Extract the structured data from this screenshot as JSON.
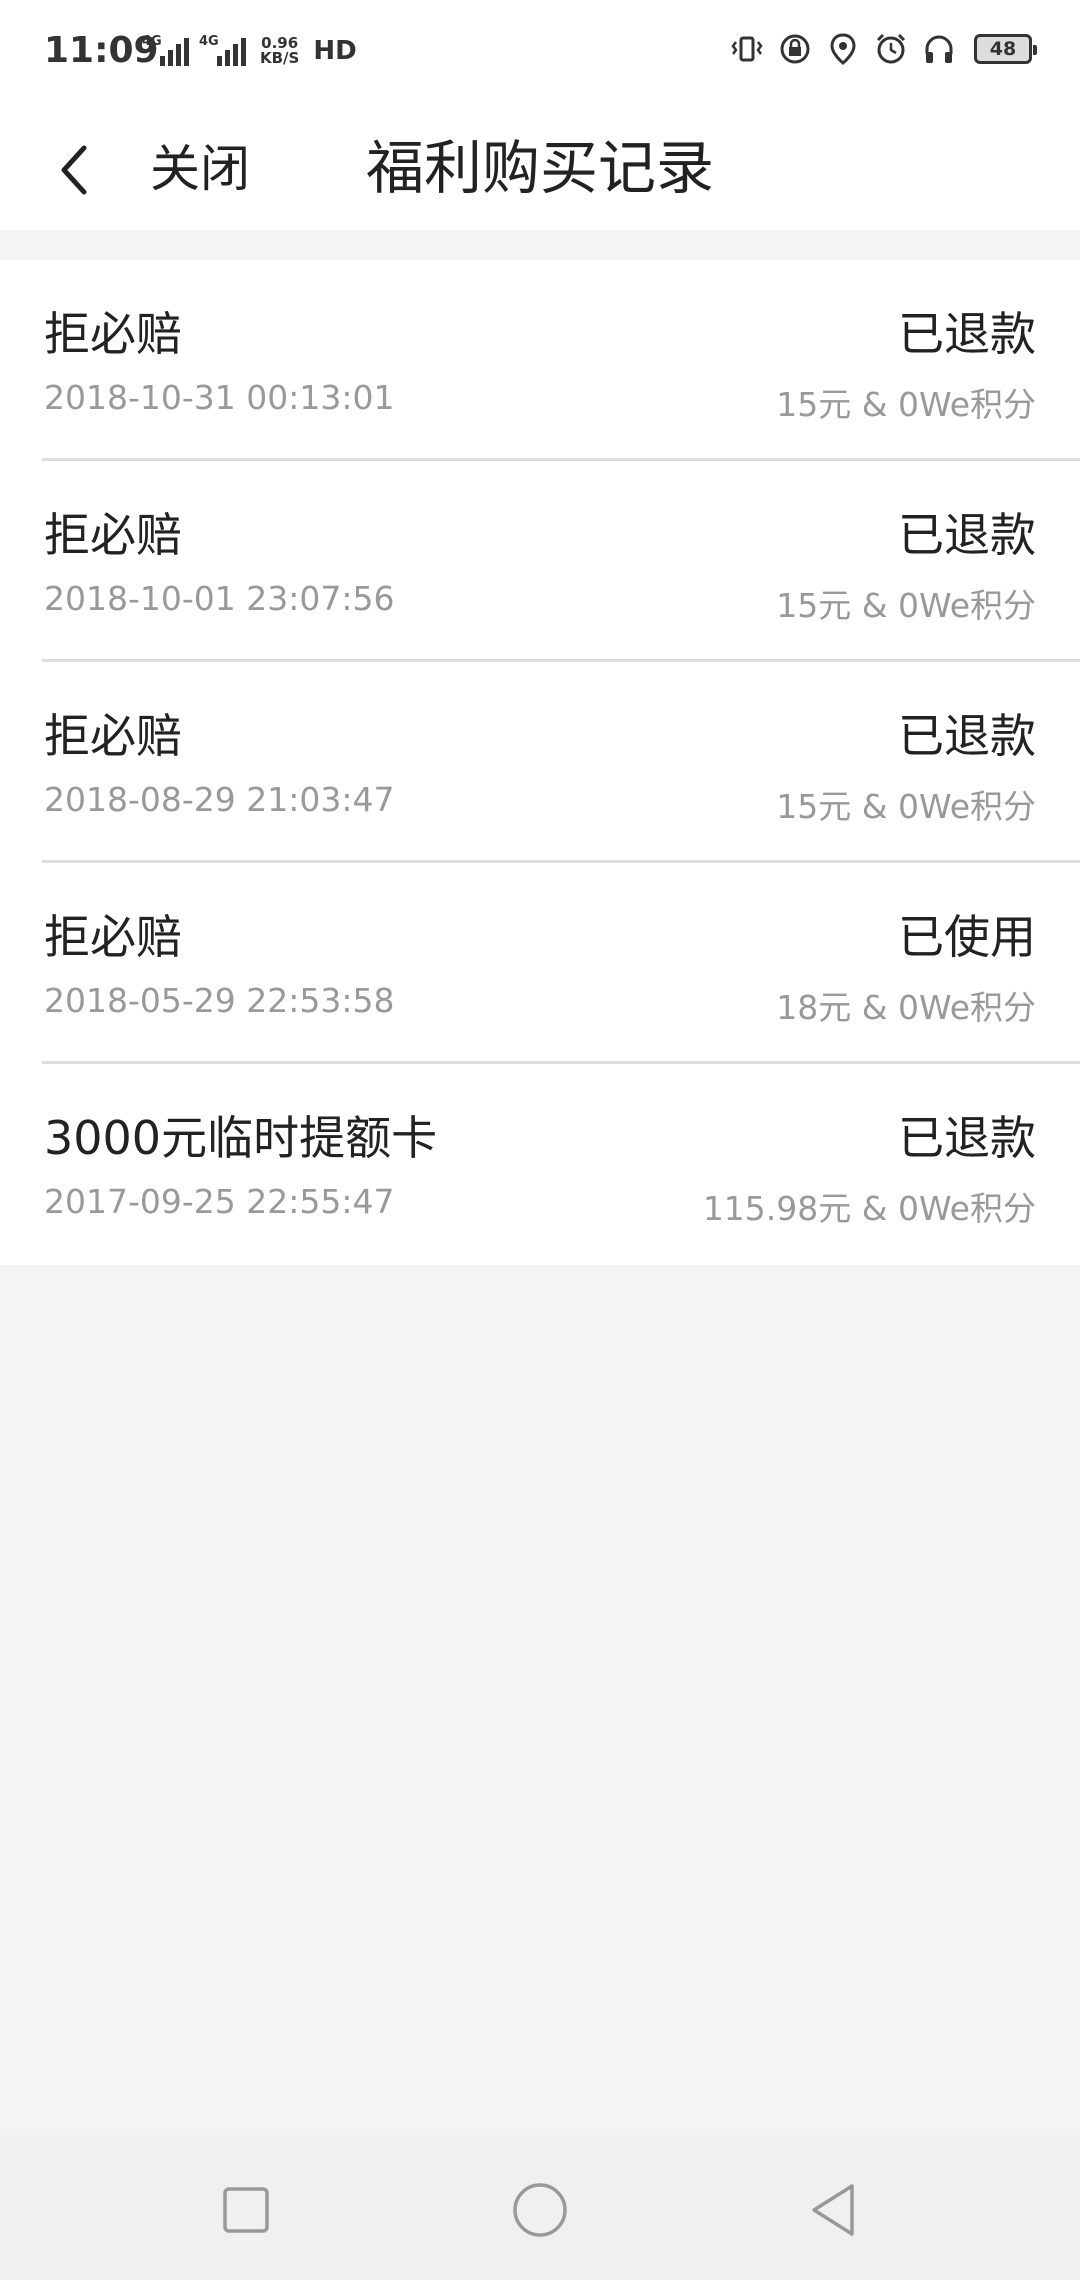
{
  "status_bar": {
    "time": "11:09",
    "net1": "4G",
    "net2": "4G",
    "speed_value": "0.96",
    "speed_unit": "KB/S",
    "hd": "HD",
    "battery": "48"
  },
  "header": {
    "close_label": "关闭",
    "title": "福利购买记录"
  },
  "records": [
    {
      "name": "拒必赔",
      "status": "已退款",
      "time": "2018-10-31 00:13:01",
      "price": "15元 & 0We积分"
    },
    {
      "name": "拒必赔",
      "status": "已退款",
      "time": "2018-10-01 23:07:56",
      "price": "15元 & 0We积分"
    },
    {
      "name": "拒必赔",
      "status": "已退款",
      "time": "2018-08-29 21:03:47",
      "price": "15元 & 0We积分"
    },
    {
      "name": "拒必赔",
      "status": "已使用",
      "time": "2018-05-29 22:53:58",
      "price": "18元 & 0We积分"
    },
    {
      "name": "3000元临时提额卡",
      "status": "已退款",
      "time": "2017-09-25 22:55:47",
      "price": "115.98元 & 0We积分"
    }
  ],
  "icons": {
    "back": "chevron-left-icon",
    "vibrate": "vibrate-icon",
    "lock": "lock-rotation-icon",
    "location": "location-icon",
    "alarm": "alarm-icon",
    "headphones": "headphones-icon",
    "nav_recent": "square-icon",
    "nav_home": "circle-icon",
    "nav_back": "triangle-back-icon"
  }
}
